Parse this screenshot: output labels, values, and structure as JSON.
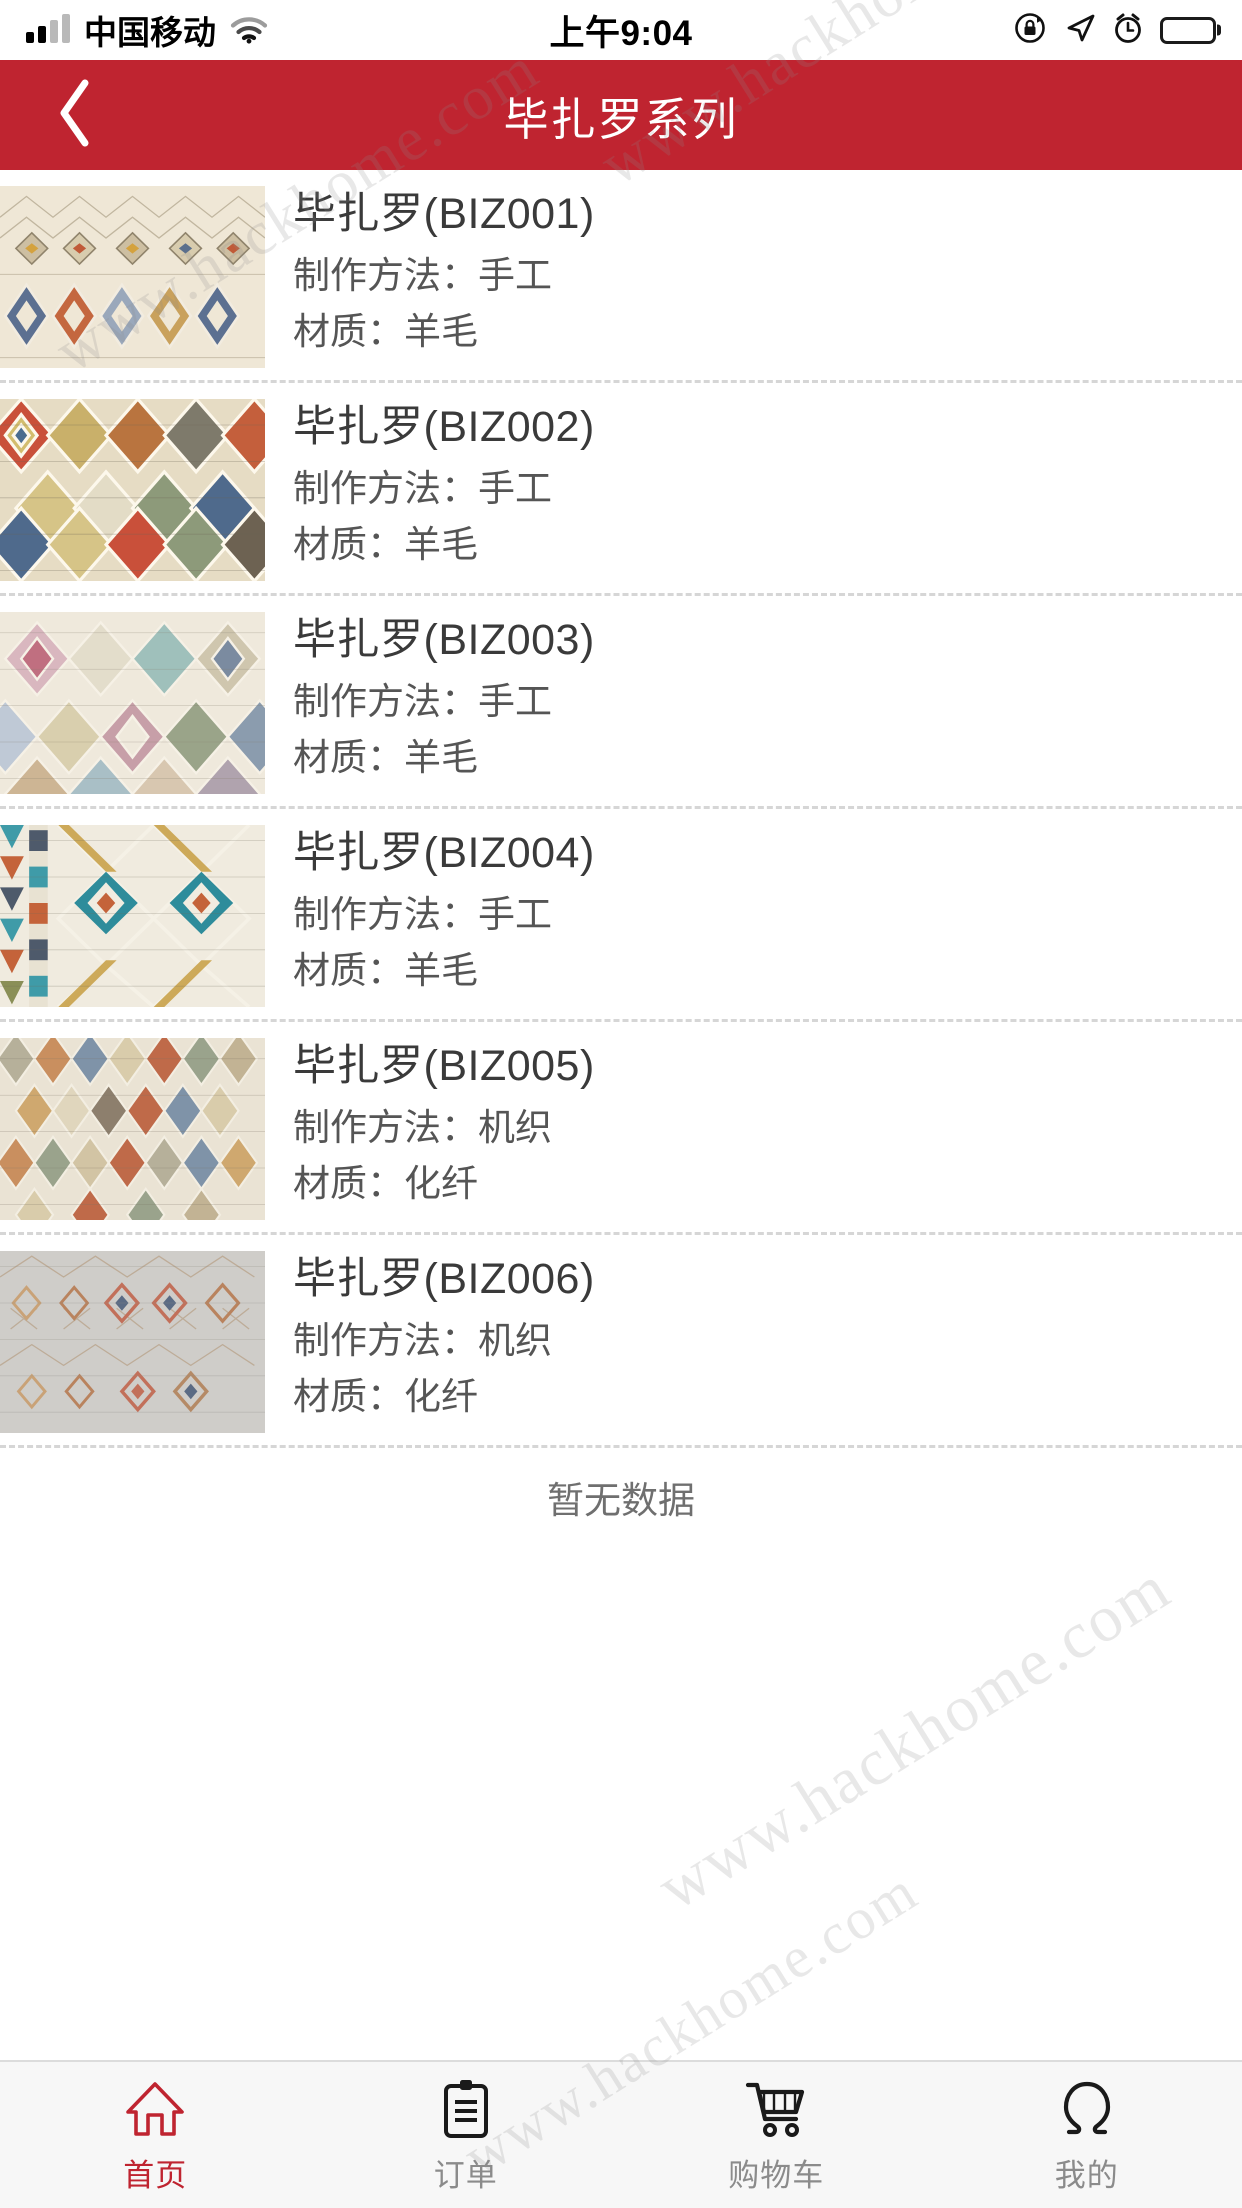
{
  "status_bar": {
    "carrier": "中国移动",
    "time": "上午9:04",
    "icons": [
      "signal-bars-icon",
      "wifi-icon",
      "rotation-lock-icon",
      "location-arrow-icon",
      "alarm-clock-icon",
      "battery-icon"
    ]
  },
  "header": {
    "title": "毕扎罗系列",
    "back_icon": "chevron-left-icon",
    "background_color": "#bf2430",
    "title_color": "#ffffff"
  },
  "list": {
    "items": [
      {
        "title": "毕扎罗(BIZ001)",
        "method_line": "制作方法：手工",
        "material_line": "材质：羊毛",
        "thumb": "rug-biz001"
      },
      {
        "title": "毕扎罗(BIZ002)",
        "method_line": "制作方法：手工",
        "material_line": "材质：羊毛",
        "thumb": "rug-biz002"
      },
      {
        "title": "毕扎罗(BIZ003)",
        "method_line": "制作方法：手工",
        "material_line": "材质：羊毛",
        "thumb": "rug-biz003"
      },
      {
        "title": "毕扎罗(BIZ004)",
        "method_line": "制作方法：手工",
        "material_line": "材质：羊毛",
        "thumb": "rug-biz004"
      },
      {
        "title": "毕扎罗(BIZ005)",
        "method_line": "制作方法：机织",
        "material_line": "材质：化纤",
        "thumb": "rug-biz005"
      },
      {
        "title": "毕扎罗(BIZ006)",
        "method_line": "制作方法：机织",
        "material_line": "材质：化纤",
        "thumb": "rug-biz006"
      }
    ],
    "end_note": "暂无数据"
  },
  "tab_bar": {
    "active_color": "#bf2430",
    "inactive_color": "#8b8b8b",
    "items": [
      {
        "label": "首页",
        "icon": "home-icon",
        "active": true
      },
      {
        "label": "订单",
        "icon": "clipboard-icon",
        "active": false
      },
      {
        "label": "购物车",
        "icon": "cart-icon",
        "active": false
      },
      {
        "label": "我的",
        "icon": "person-icon",
        "active": false
      }
    ]
  },
  "watermarks": {
    "w1": "www.hackhome.com",
    "w2": "www.hackhome.com",
    "w3": "www.hackhome.com",
    "w4": "www.hackhome.com"
  }
}
